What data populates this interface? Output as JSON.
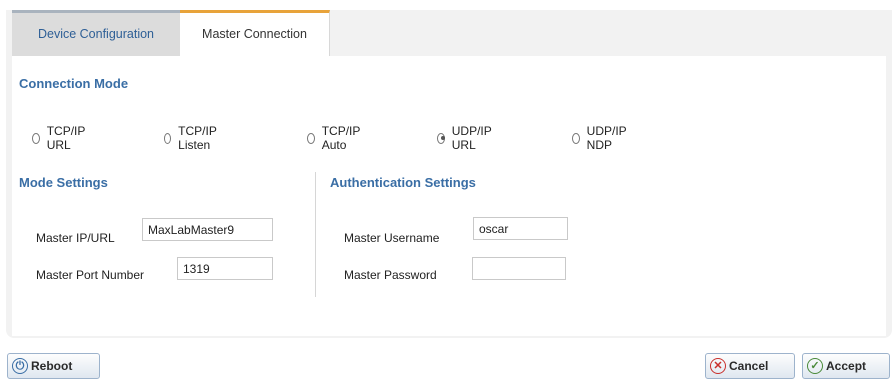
{
  "tabs": [
    {
      "label": "Device Configuration",
      "active": false
    },
    {
      "label": "Master Connection",
      "active": true
    }
  ],
  "connection_mode": {
    "title": "Connection Mode",
    "options": [
      {
        "label": "TCP/IP URL",
        "selected": false
      },
      {
        "label": "TCP/IP Listen",
        "selected": false
      },
      {
        "label": "TCP/IP Auto",
        "selected": false
      },
      {
        "label": "UDP/IP URL",
        "selected": true
      },
      {
        "label": "UDP/IP NDP",
        "selected": false
      }
    ]
  },
  "mode_settings": {
    "title": "Mode Settings",
    "master_ip_label": "Master IP/URL",
    "master_ip_value": "MaxLabMaster9",
    "master_port_label": "Master Port Number",
    "master_port_value": "1319"
  },
  "auth_settings": {
    "title": "Authentication Settings",
    "username_label": "Master Username",
    "username_value": "oscar",
    "password_label": "Master Password",
    "password_value": ""
  },
  "buttons": {
    "reboot": "Reboot",
    "cancel": "Cancel",
    "accept": "Accept"
  },
  "icons": {
    "reboot": "power-icon",
    "cancel": "cancel-x-icon",
    "accept": "checkmark-icon"
  },
  "colors": {
    "section_title": "#3a6ea5",
    "active_tab_accent": "#e8a33a"
  }
}
